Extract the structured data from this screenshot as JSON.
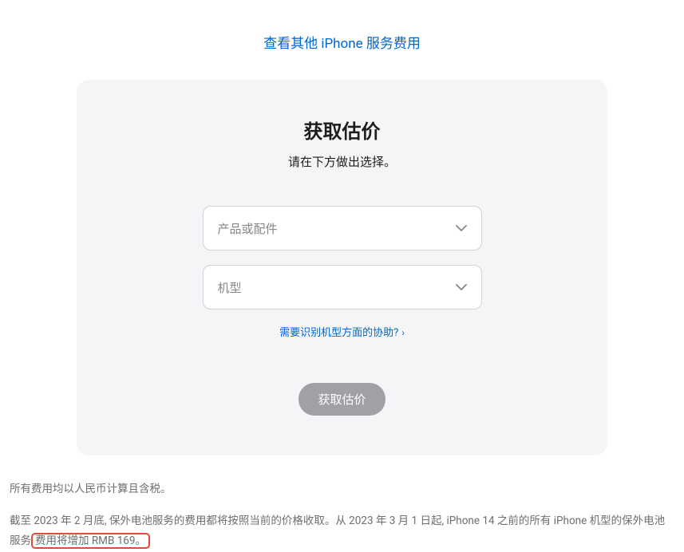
{
  "top_link": "查看其他 iPhone 服务费用",
  "card": {
    "title": "获取估价",
    "subtitle": "请在下方做出选择。",
    "select_product_placeholder": "产品或配件",
    "select_model_placeholder": "机型",
    "help_link": "需要识别机型方面的协助?",
    "submit_button": "获取估价"
  },
  "footer": {
    "line1": "所有费用均以人民币计算且含税。",
    "line2_part1": "截至 2023 年 2 月底, 保外电池服务的费用都将按照当前的价格收取。从 2023 年 3 月 1 日起, iPhone 14 之前的所有 iPhone 机型的保外电池服务",
    "line2_highlight": "费用将增加 RMB 169。"
  }
}
